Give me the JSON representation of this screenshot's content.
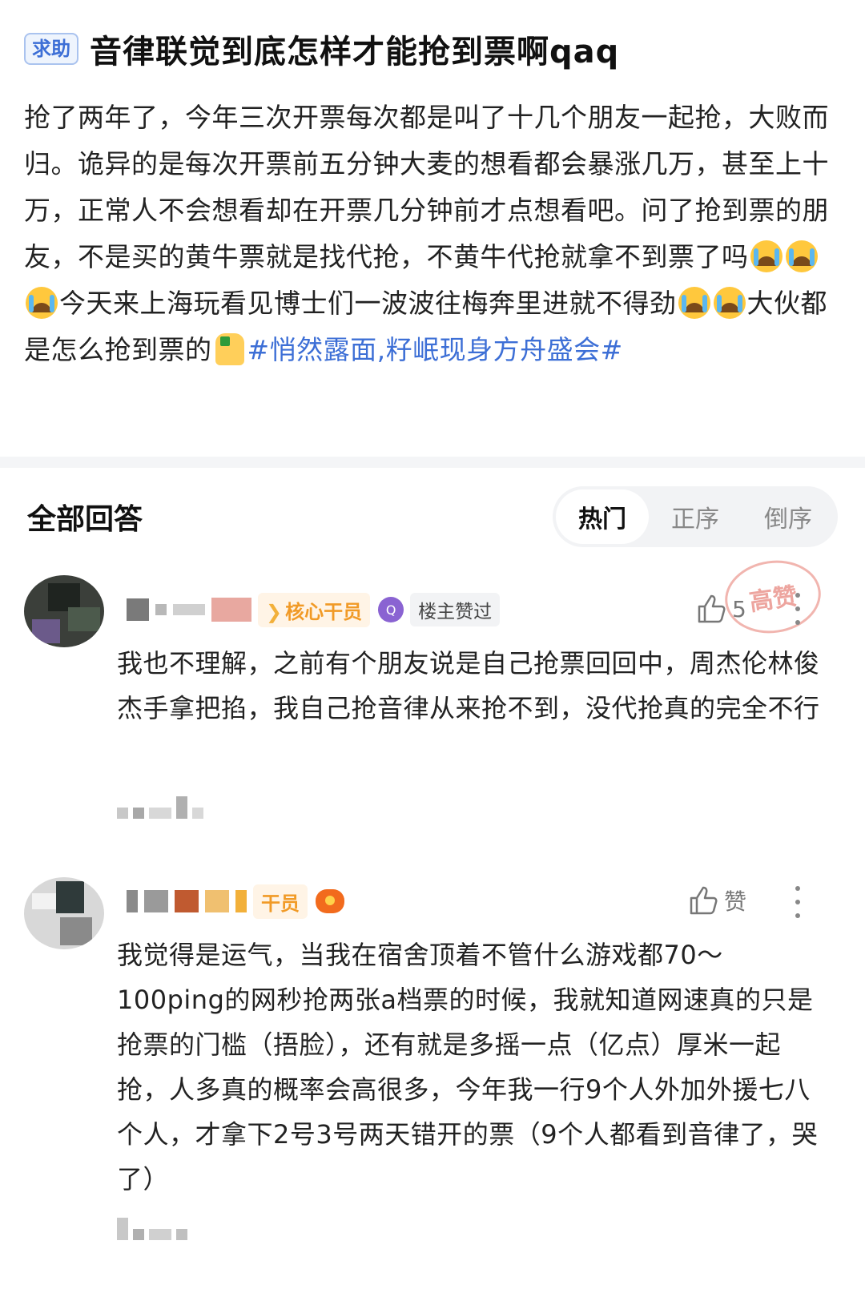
{
  "post": {
    "tag": "求助",
    "title": "音律联觉到底怎样才能抢到票啊qaq",
    "body_p1": "抢了两年了，今年三次开票每次都是叫了十几个朋友一起抢，大败而归。诡异的是每次开票前五分钟大麦的想看都会暴涨几万，甚至上十万，正常人不会想看却在开票几分钟前才点想看吧。问了抢到票的朋友，不是买的黄牛票就是找代抢，不黄牛代抢就拿不到票了吗",
    "body_p2": "今天来上海玩看见博士们一波波往梅奔里进就不得劲",
    "body_p3": "大伙都是怎么抢到票的",
    "hashtag": "#悄然露面,籽岷现身方舟盛会#"
  },
  "answers_section": {
    "title": "全部回答",
    "tabs": [
      {
        "label": "热门",
        "active": true
      },
      {
        "label": "正序",
        "active": false
      },
      {
        "label": "倒序",
        "active": false
      }
    ]
  },
  "answers": [
    {
      "badge": "核心干员",
      "owner_liked": "楼主赞过",
      "likes": "5",
      "stamp": "高赞",
      "text": "我也不理解，之前有个朋友说是自己抢票回回中，周杰伦林俊杰手拿把掐，我自己抢音律从来抢不到，没代抢真的完全不行"
    },
    {
      "badge": "干员",
      "likes": "赞",
      "text": "我觉得是运气，当我在宿舍顶着不管什么游戏都70～100ping的网秒抢两张a档票的时候，我就知道网速真的只是抢票的门槛（捂脸），还有就是多摇一点（亿点）厚米一起抢，人多真的概率会高很多，今年我一行9个人外加外援七八个人，才拿下2号3号两天错开的票（9个人都看到音律了，哭了）"
    }
  ],
  "colors": {
    "accent_blue": "#3d6fd6",
    "badge_orange": "#f19a26",
    "stamp_red": "#e1695f"
  }
}
